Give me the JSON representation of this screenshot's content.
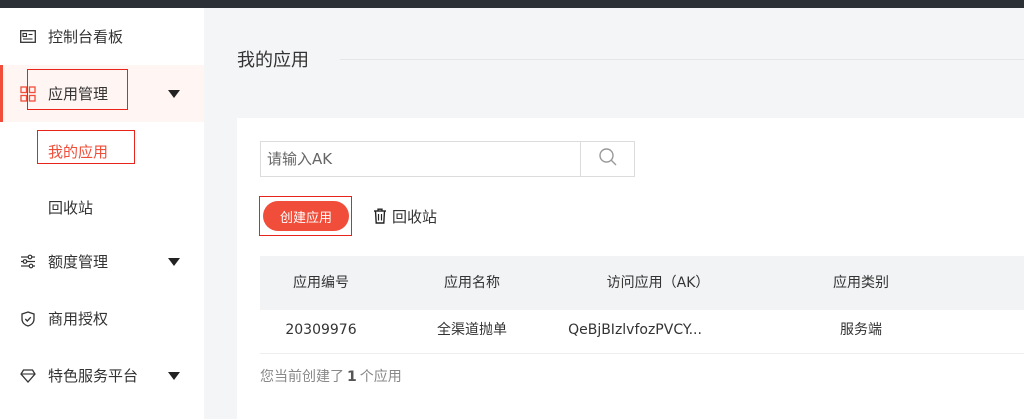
{
  "sidebar": {
    "items": [
      {
        "label": "控制台看板",
        "icon": "id-card-icon"
      },
      {
        "label": "应用管理",
        "icon": "grid-icon",
        "expanded": true,
        "children": [
          {
            "label": "我的应用",
            "active": true
          },
          {
            "label": "回收站"
          }
        ]
      },
      {
        "label": "额度管理",
        "icon": "sliders-icon"
      },
      {
        "label": "商用授权",
        "icon": "shield-check-icon"
      },
      {
        "label": "特色服务平台",
        "icon": "gem-icon"
      }
    ]
  },
  "main": {
    "title": "我的应用",
    "search": {
      "placeholder": "请输入AK",
      "value": ""
    },
    "actions": {
      "create_label": "创建应用",
      "recycle_label": "回收站"
    },
    "table": {
      "columns": [
        "应用编号",
        "应用名称",
        "访问应用（AK）",
        "应用类别"
      ],
      "rows": [
        [
          "20309976",
          "全渠道抛单",
          "QeBjBIzlvfozPVCY...",
          "服务端"
        ]
      ]
    },
    "count": {
      "prefix": "您当前创建了",
      "number": "1",
      "suffix": "个应用"
    }
  },
  "colors": {
    "accent": "#f04e3a",
    "highlight": "#e8241a",
    "sidebar_active_bg": "#fff5f3"
  }
}
